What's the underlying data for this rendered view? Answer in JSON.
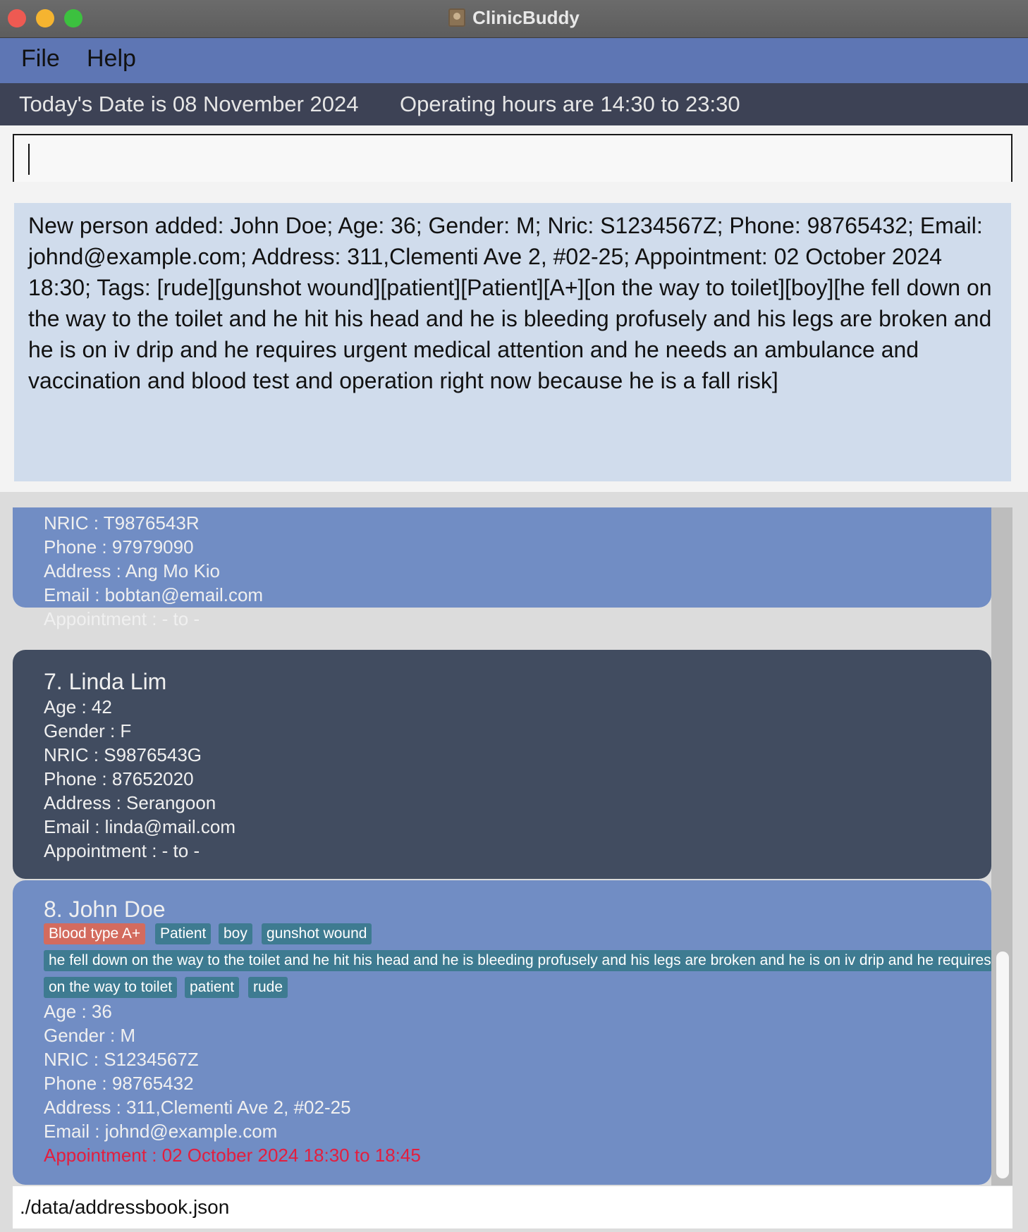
{
  "window": {
    "title": "ClinicBuddy"
  },
  "menu": {
    "file": "File",
    "help": "Help"
  },
  "status": {
    "date": "Today's Date is 08 November 2024",
    "hours": "Operating hours are 14:30 to 23:30"
  },
  "command": {
    "value": ""
  },
  "result": {
    "text": "New person added: John Doe; Age: 36; Gender: M; Nric: S1234567Z; Phone: 98765432; Email: johnd@example.com; Address: 311,Clementi Ave 2, #02-25; Appointment: 02 October 2024 18:30; Tags: [rude][gunshot wound][patient][Patient][A+][on the way to toilet][boy][he fell down on the way to the toilet and he hit his head and he is bleeding profusely and his legs are broken and he is on iv drip and he requires urgent medical attention and he needs an ambulance and vaccination and blood test and operation right now because he is a fall risk]"
  },
  "persons": {
    "bob": {
      "nric": "NRIC : T9876543R",
      "phone": "Phone : 97979090",
      "address": "Address : Ang Mo Kio",
      "email": "Email : bobtan@email.com",
      "appointment": "Appointment : - to -"
    },
    "linda": {
      "name": "7. Linda Lim",
      "age": "Age : 42",
      "gender": "Gender : F",
      "nric": "NRIC : S9876543G",
      "phone": "Phone : 87652020",
      "address": "Address : Serangoon",
      "email": "Email : linda@mail.com",
      "appointment": "Appointment : - to -"
    },
    "john": {
      "name": "8. John Doe",
      "tags": {
        "blood": "Blood type A+",
        "patient_cap": "Patient",
        "boy": "boy",
        "gunshot": "gunshot wound",
        "long": "he fell down on the way to the toilet and he hit his head and he is bleeding profusely and his legs are broken and he is on iv drip and he requires urgent medical attention and he needs an ambulance and vaccination and blood test and operation right now because he is a fall risk",
        "toilet": "on the way to toilet",
        "patient": "patient",
        "rude": "rude"
      },
      "age": "Age : 36",
      "gender": "Gender : M",
      "nric": "NRIC : S1234567Z",
      "phone": "Phone : 98765432",
      "address": "Address : 311,Clementi Ave 2, #02-25",
      "email": "Email : johnd@example.com",
      "appointment": "Appointment : 02 October 2024 18:30 to 18:45"
    }
  },
  "footer": {
    "path": "./data/addressbook.json"
  },
  "colors": {
    "menubar": "#5e76b4",
    "statusbar": "#3d4255",
    "card_blue": "#718dc4",
    "card_dark": "#414c60",
    "tag": "#3e7b91",
    "tag_blood": "#d36b5e",
    "appointment_alert": "#e31e3e"
  }
}
